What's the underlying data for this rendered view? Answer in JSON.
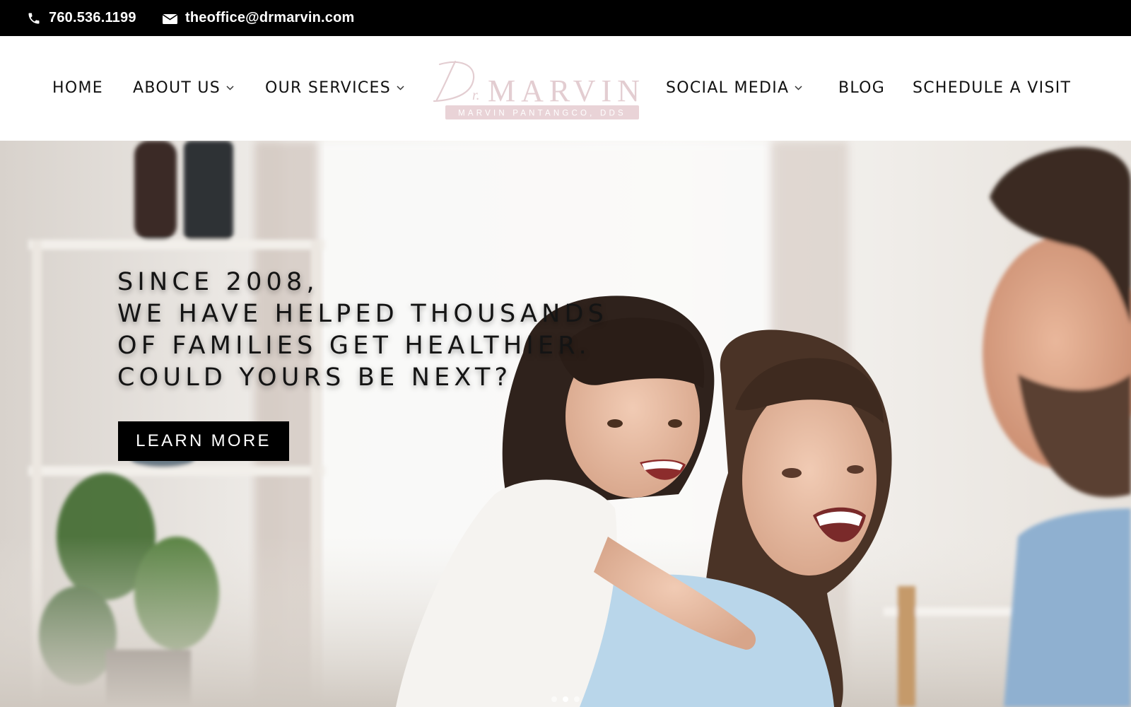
{
  "topbar": {
    "phone": "760.536.1199",
    "email": "theoffice@drmarvin.com",
    "phone_icon": "phone-icon",
    "email_icon": "envelope-icon"
  },
  "nav": {
    "home": "HOME",
    "about": "ABOUT US",
    "services": "OUR SERVICES",
    "social": "SOCIAL MEDIA",
    "blog": "BLOG",
    "schedule": "SCHEDULE A VISIT",
    "dropdown_icon": "chevron-down-icon"
  },
  "logo": {
    "name": "Dr.MARVIN",
    "tagline": "MARVIN PANTANGCO, DDS"
  },
  "hero": {
    "lines": [
      "SINCE 2008,",
      "WE HAVE HELPED THOUSANDS",
      "OF FAMILIES GET HEALTHIER.",
      "COULD YOURS BE NEXT?"
    ],
    "button": "LEARN MORE"
  },
  "colors": {
    "topbar_bg": "#000000",
    "logo_pink": "#e3cdd1",
    "button_bg": "#000000"
  }
}
